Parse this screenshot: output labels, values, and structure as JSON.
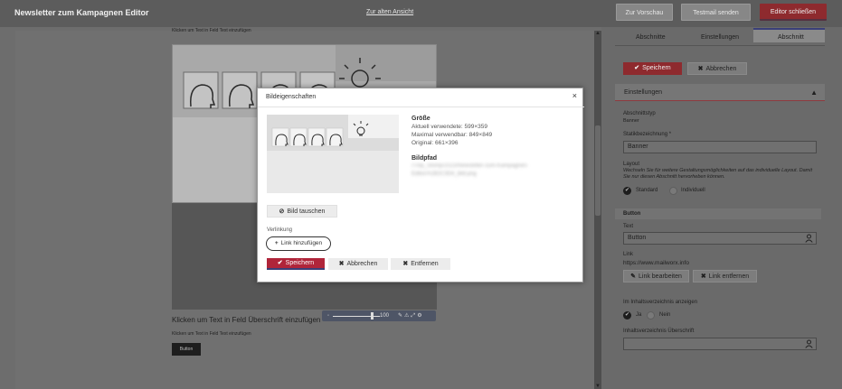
{
  "header": {
    "title": "Newsletter zum Kampagnen Editor",
    "old_view_link": "Zur alten Ansicht",
    "preview_label": "Zur Vorschau",
    "testmail_label": "Testmail senden",
    "close_editor_label": "Editor schließen"
  },
  "canvas": {
    "hint_text_top": "Klicken um Text in Feld Text einzufügen",
    "heading_hint": "Klicken um Text in Feld Überschrift einzufügen",
    "hint_text_bottom": "Klicken um Text in Feld Text einzufügen",
    "button_label": "Button",
    "zoom_value": "100"
  },
  "sidebar": {
    "tabs": [
      "Abschnitte",
      "Einstellungen",
      "Abschnitt"
    ],
    "active_tab": "Abschnitt",
    "save_label": "Speichern",
    "cancel_label": "Abbrechen",
    "section_title": "Einstellungen",
    "section_type_label": "Abschnittstyp",
    "section_type_value": "Banner",
    "static_name_label": "Statikbezeichnung *",
    "static_name_value": "Banner",
    "layout_label": "Layout",
    "layout_desc": "Wechseln Sie für weitere Gestaltungsmöglichkeiten auf das individuelle Layout. Damit Sie nur diesen Abschnitt hervorheben können.",
    "layout_option_standard": "Standard",
    "layout_option_individual": "Individuell",
    "layout_selected": "Standard",
    "button_section_title": "Button",
    "text_label": "Text",
    "text_value": "Button",
    "link_label": "Link",
    "link_value": "https://www.mailworx.info",
    "edit_link_label": "Link bearbeiten",
    "remove_link_label": "Link entfernen",
    "toc_label": "Im Inhaltsverzeichnis anzeigen",
    "toc_yes": "Ja",
    "toc_no": "Nein",
    "toc_selected": "Ja",
    "toc_heading_label": "Inhaltsverzeichnis Überschrift",
    "toc_heading_value": ""
  },
  "modal": {
    "title": "Bildeigenschaften",
    "size_heading": "Größe",
    "current_used": "Aktuell verwendete: 599×359",
    "max_usable": "Maximal verwendbar: 849×849",
    "original": "Original: 661×396",
    "path_heading": "Bildpfad",
    "path_value": "/Tmp_Stomp/2023/Newsletter-zum-Kampagnen-Editor/A1B2C3D4_bild.png",
    "swap_image_label": "Bild tauschen",
    "link_section_label": "Verlinkung",
    "add_link_label": "Link hinzufügen",
    "save_label": "Speichern",
    "cancel_label": "Abbrechen",
    "remove_label": "Entfernen"
  },
  "colors": {
    "accent_red": "#b0253a",
    "accent_navy": "#3a3f78"
  },
  "icons": [
    "check-icon",
    "close-icon",
    "image-swap-icon",
    "plus-icon",
    "pencil-icon",
    "user-icon",
    "chevron-up-icon",
    "lightbulb-icon",
    "head-icon"
  ]
}
